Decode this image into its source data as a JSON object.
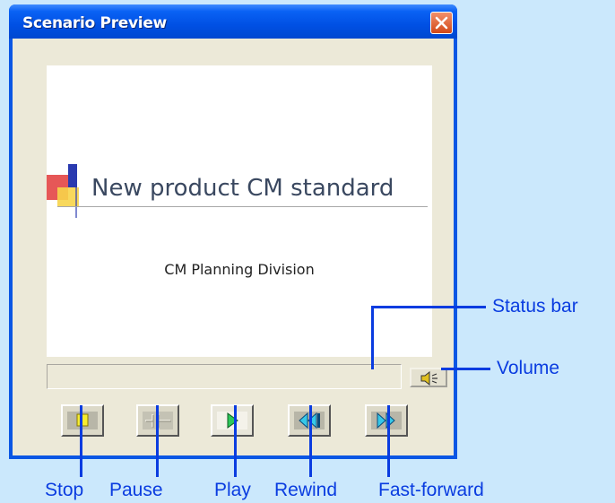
{
  "window": {
    "title": "Scenario Preview"
  },
  "preview": {
    "slide_title": "New product CM standard",
    "slide_subtitle": "CM Planning Division"
  },
  "controls": [
    {
      "name": "stop",
      "icon": "stop-icon"
    },
    {
      "name": "pause",
      "icon": "pause-icon"
    },
    {
      "name": "play",
      "icon": "play-icon"
    },
    {
      "name": "rewind",
      "icon": "rewind-icon"
    },
    {
      "name": "fast-forward",
      "icon": "fast-forward-icon"
    }
  ],
  "callouts": {
    "status_bar": "Status bar",
    "volume": "Volume",
    "stop": "Stop",
    "pause": "Pause",
    "play": "Play",
    "rewind": "Rewind",
    "fast_forward": "Fast-forward"
  },
  "colors": {
    "background": "#cbe8fc",
    "titlebar": "#0050e4",
    "close_button": "#d24818",
    "callout": "#0a3ce0",
    "window_face": "#ece9d8"
  }
}
